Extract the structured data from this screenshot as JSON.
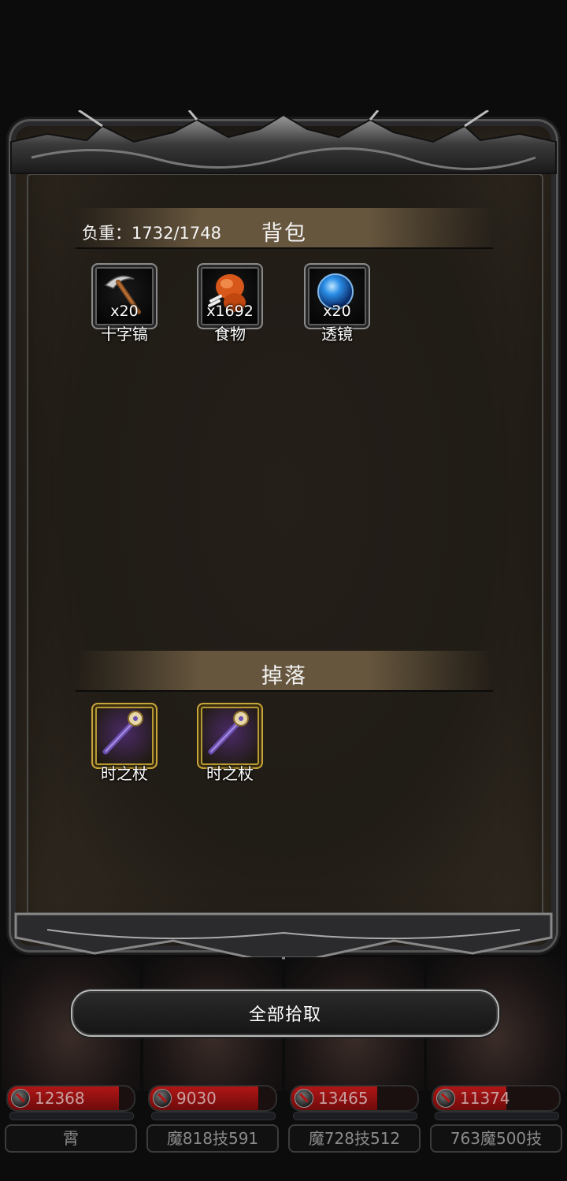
{
  "bag": {
    "title": "背包",
    "weight": "负重：1732/1748",
    "items": [
      {
        "name": "十字镐",
        "qty": "x20",
        "icon": "pickaxe-icon"
      },
      {
        "name": "食物",
        "qty": "x1692",
        "icon": "food-icon"
      },
      {
        "name": "透镜",
        "qty": "x20",
        "icon": "lens-icon"
      }
    ]
  },
  "drops": {
    "title": "掉落",
    "items": [
      {
        "name": "时之杖",
        "icon": "staff-icon"
      },
      {
        "name": "时之杖",
        "icon": "staff-icon"
      }
    ]
  },
  "pickup_all": "全部拾取",
  "heroes": [
    {
      "hp": "12368",
      "hp_fraction": 0.88,
      "tag": "霄"
    },
    {
      "hp": "9030",
      "hp_fraction": 0.86,
      "tag": "魔818技591"
    },
    {
      "hp": "13465",
      "hp_fraction": 0.68,
      "tag": "魔728技512"
    },
    {
      "hp": "11374",
      "hp_fraction": 0.58,
      "tag": "763魔500技"
    }
  ],
  "colors": {
    "hp_bar": "#b11616",
    "legendary_border": "#c9a63a"
  }
}
